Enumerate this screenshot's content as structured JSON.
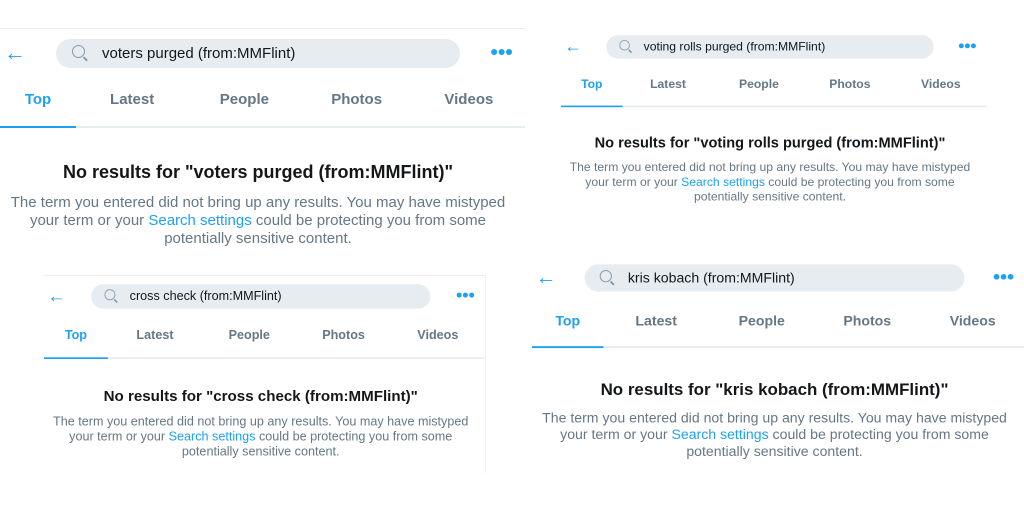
{
  "common": {
    "tabs": [
      "Top",
      "Latest",
      "People",
      "Photos",
      "Videos"
    ],
    "body_before": "The term you entered did not bring up any results. You may have mistyped your term or your ",
    "link": "Search settings",
    "body_after": " could be protecting you from some potentially sensitive content.",
    "back_icon": "arrow-left-icon",
    "more_icon": "more-dots-icon",
    "dots": "●●●",
    "back": "←",
    "accent": "#1da1f2"
  },
  "panels": [
    {
      "query": "voters purged (from:MMFlint)",
      "heading": "No results for \"voters purged (from:MMFlint)\""
    },
    {
      "query": "voting rolls purged (from:MMFlint)",
      "heading": "No results for \"voting rolls purged (from:MMFlint)\""
    },
    {
      "query": "cross check (from:MMFlint)",
      "heading": "No results for \"cross check (from:MMFlint)\""
    },
    {
      "query": "kris kobach (from:MMFlint)",
      "heading": "No results for \"kris kobach (from:MMFlint)\""
    }
  ]
}
